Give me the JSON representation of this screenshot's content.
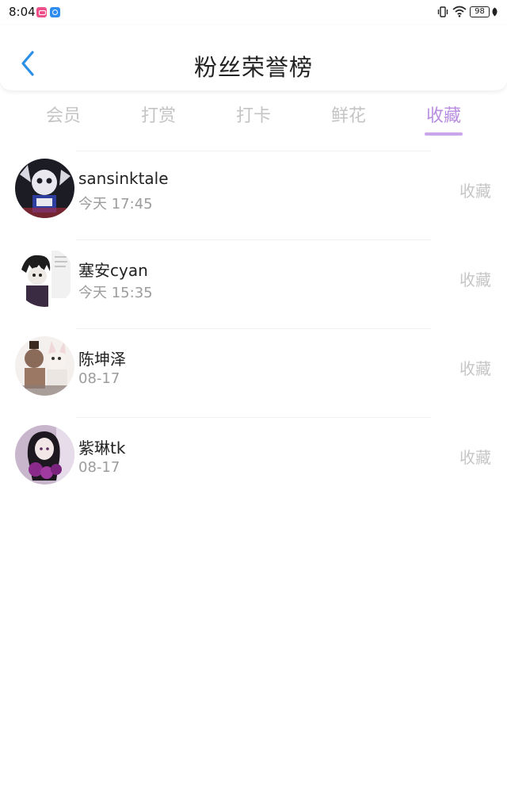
{
  "status_bar": {
    "time": "8:04",
    "battery": "98",
    "icons": [
      "pink-app-icon",
      "blue-app-icon",
      "vibrate-icon",
      "wifi-icon",
      "battery-icon",
      "leaf-icon"
    ]
  },
  "header": {
    "title": "粉丝荣誉榜",
    "back_icon": "chevron-left-icon"
  },
  "tabs": [
    {
      "label": "会员",
      "active": false
    },
    {
      "label": "打赏",
      "active": false
    },
    {
      "label": "打卡",
      "active": false
    },
    {
      "label": "鲜花",
      "active": false
    },
    {
      "label": "收藏",
      "active": true
    }
  ],
  "fans": [
    {
      "name": "sansinktale",
      "time": "今天 17:45",
      "action": "收藏"
    },
    {
      "name": "塞安cyan",
      "time": "今天 15:35",
      "action": "收藏"
    },
    {
      "name": "陈坤泽",
      "time": "08-17",
      "action": "收藏"
    },
    {
      "name": "紫琳tk",
      "time": "08-17",
      "action": "收藏"
    }
  ],
  "colors": {
    "accent": "#b98ee0",
    "tab_inactive": "#c4c4c4",
    "back_arrow": "#2b8fe6",
    "action_text": "#c6c6c6"
  }
}
